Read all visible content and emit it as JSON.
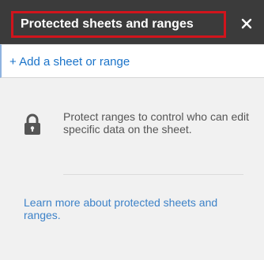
{
  "header": {
    "title": "Protected sheets and ranges",
    "close_label": "×",
    "close_icon": "close-icon",
    "background": "#3b3b3b",
    "highlight_color": "#d1141c"
  },
  "add_range": {
    "label": "+ Add a sheet or range",
    "color": "#1a73c9"
  },
  "info": {
    "icon": "lock-icon",
    "text": "Protect ranges to control who can edit specific data on the sheet.",
    "link": "Learn more about protected sheets and ranges."
  }
}
